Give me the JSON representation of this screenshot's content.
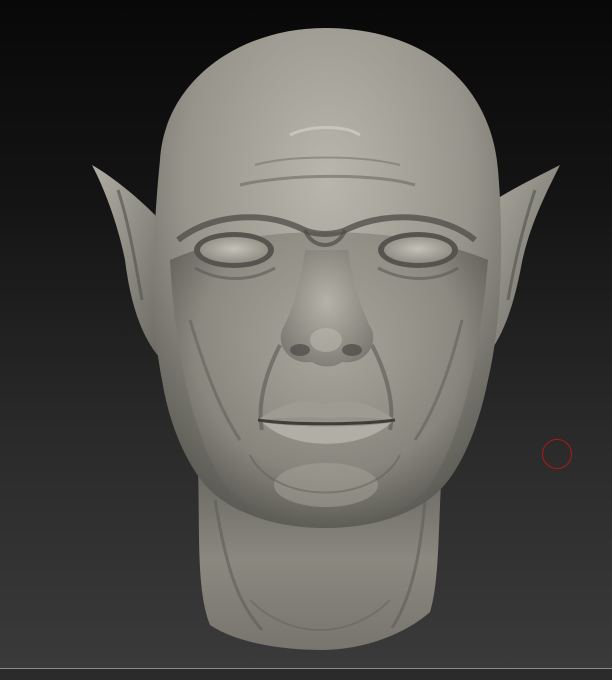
{
  "app": {
    "view": "3d-sculpt-viewport",
    "subject_icon": "sculpted-head-icon",
    "cursor_icon": "brush-circle-icon"
  },
  "colors": {
    "viewport_top": "#080808",
    "viewport_bottom": "#3a3a3a",
    "clay": "#8f8d84",
    "clay_light": "#c9c7bd",
    "clay_dark": "#3e3d38",
    "brush_ring": "#b01818",
    "bottom_bar": "#2b2b2b"
  }
}
